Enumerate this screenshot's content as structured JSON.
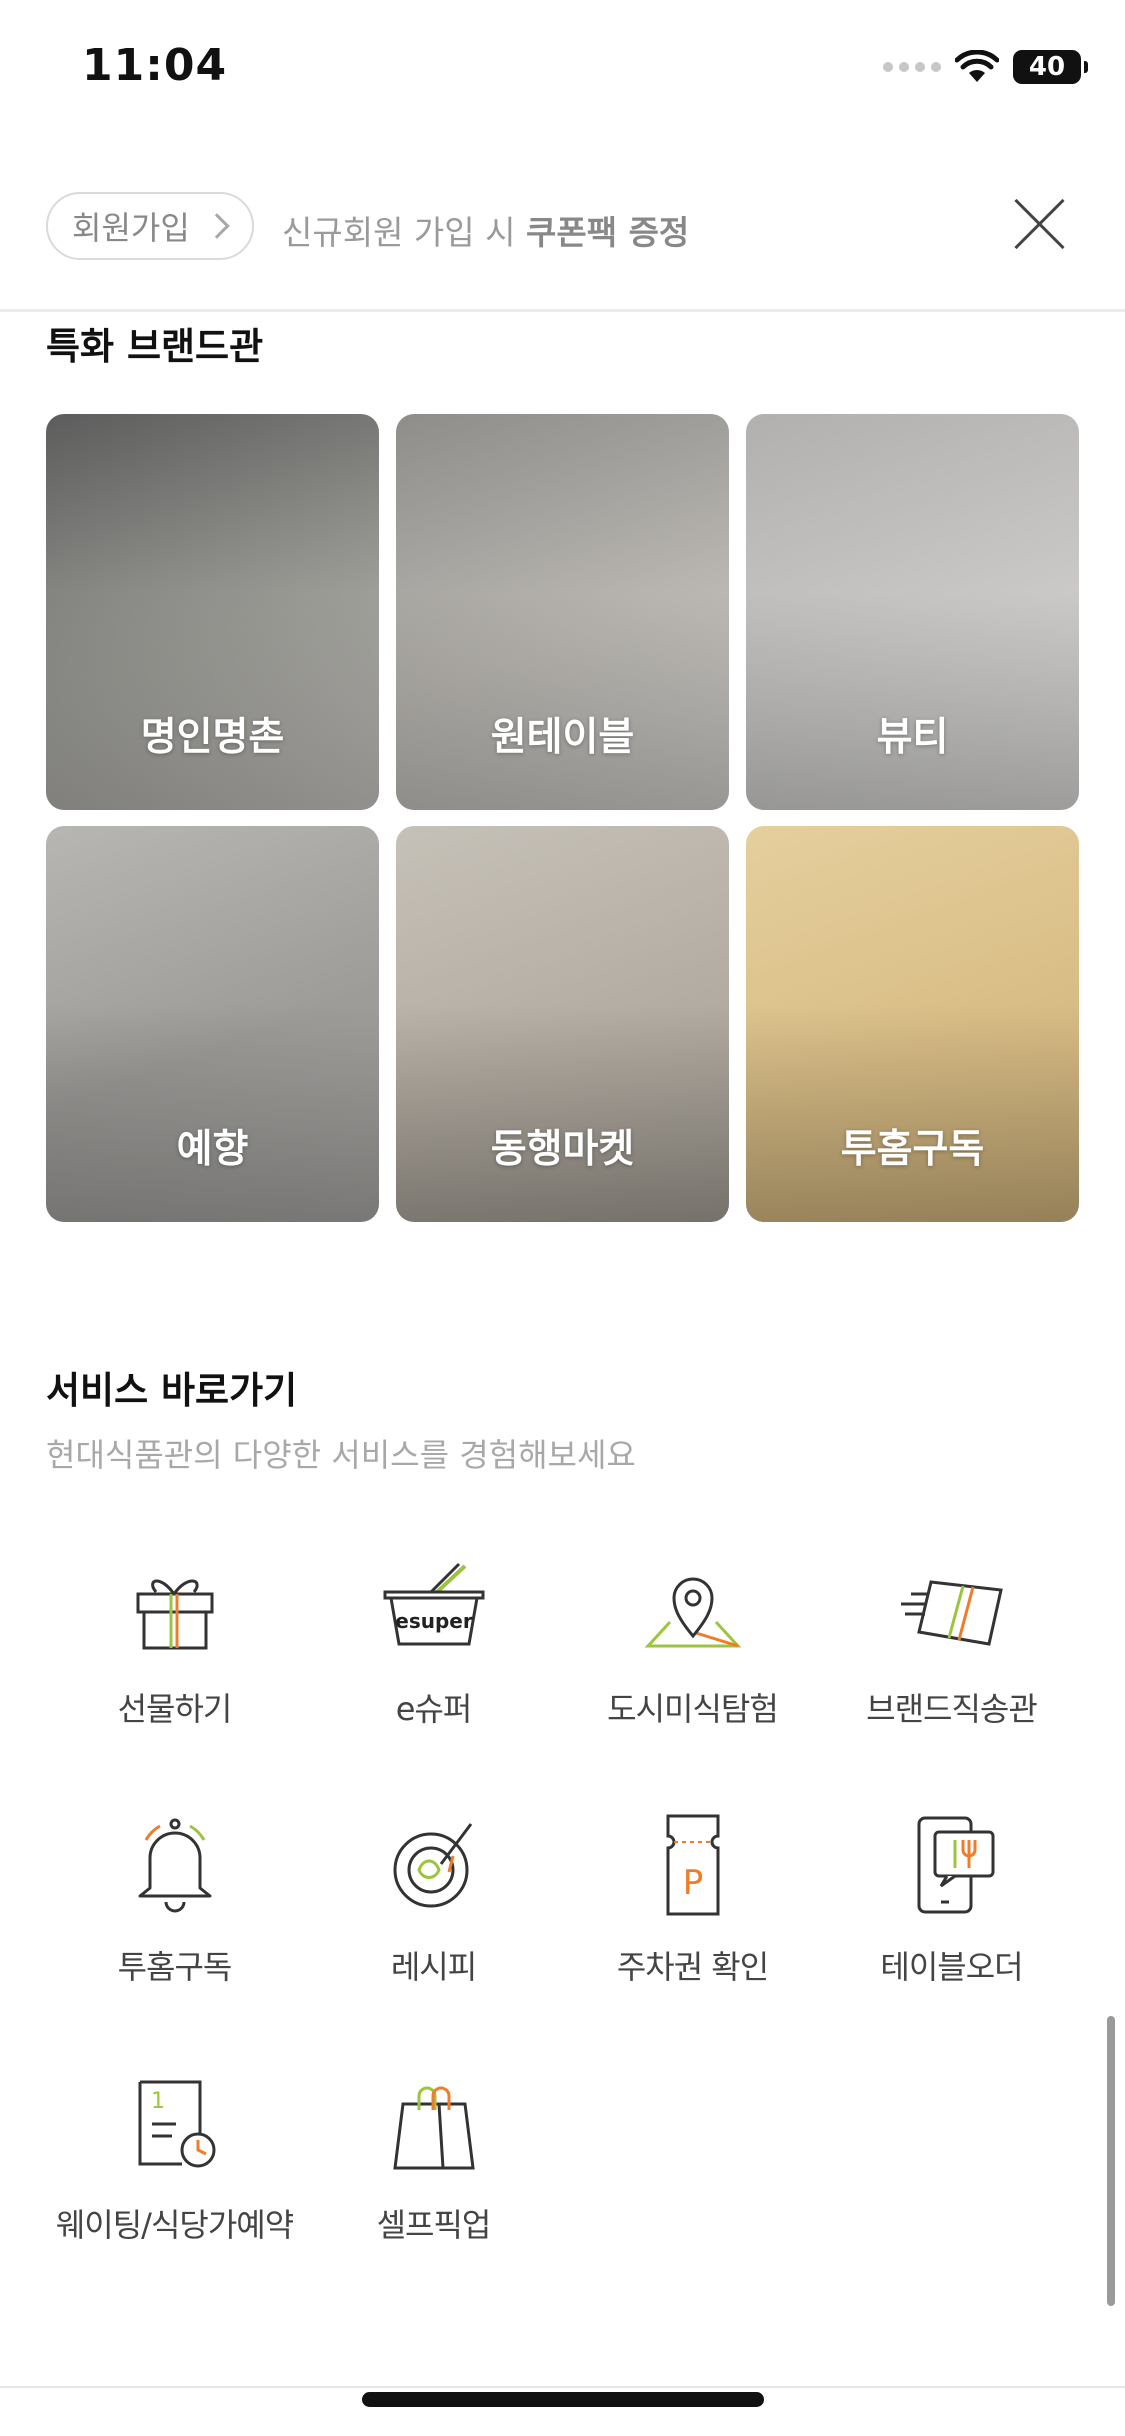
{
  "status_bar": {
    "time": "11:04",
    "battery": "40"
  },
  "join_banner": {
    "button_label": "회원가입",
    "text_prefix": "신규회원 가입 시 ",
    "text_bold": "쿠폰팩 증정"
  },
  "brands": {
    "title": "특화 브랜드관",
    "items": [
      {
        "label": "명인명촌",
        "colors": [
          "#5c5c5c",
          "#9b9b96",
          "#c9c7c2"
        ]
      },
      {
        "label": "원테이블",
        "colors": [
          "#8e8d8a",
          "#b9b6b1",
          "#d3d1cd"
        ]
      },
      {
        "label": "뷰티",
        "colors": [
          "#b1b0ae",
          "#c9c8c6",
          "#dad9d7"
        ]
      },
      {
        "label": "예향",
        "colors": [
          "#b7b6b3",
          "#9d9c99",
          "#a7a6a3"
        ]
      },
      {
        "label": "동행마켓",
        "colors": [
          "#c6c1b8",
          "#b3aca2",
          "#a39d94"
        ]
      },
      {
        "label": "투홈구독",
        "colors": [
          "#e5cf9d",
          "#d9bd86",
          "#cfb27b"
        ]
      }
    ]
  },
  "services": {
    "title": "서비스 바로가기",
    "subtitle": "현대식품관의 다양한 서비스를 경험해보세요",
    "items": [
      {
        "label": "선물하기",
        "icon": "gift-icon"
      },
      {
        "label": "e슈퍼",
        "icon": "esuper-basket-icon",
        "icon_text": "esuper"
      },
      {
        "label": "도시미식탐험",
        "icon": "map-pin-icon"
      },
      {
        "label": "브랜드직송관",
        "icon": "delivery-box-icon"
      },
      {
        "label": "투홈구독",
        "icon": "bell-icon"
      },
      {
        "label": "레시피",
        "icon": "recipe-bowl-icon"
      },
      {
        "label": "주차권 확인",
        "icon": "parking-ticket-icon",
        "icon_text": "P"
      },
      {
        "label": "테이블오더",
        "icon": "table-order-icon"
      },
      {
        "label": "웨이팅/식당가예약",
        "icon": "waiting-reservation-icon",
        "icon_text": "1"
      },
      {
        "label": "셀프픽업",
        "icon": "shopping-bag-icon"
      }
    ]
  },
  "colors": {
    "accent_orange": "#f07c2a",
    "accent_green": "#9bc53d",
    "line": "#333333"
  }
}
